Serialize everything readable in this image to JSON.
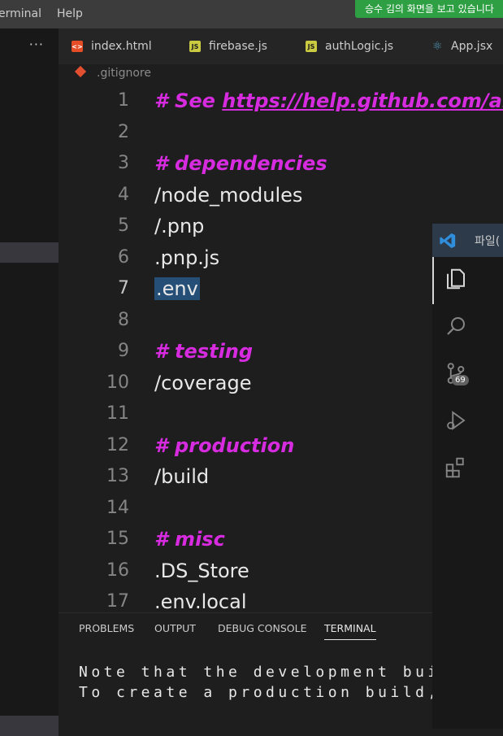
{
  "menu": {
    "terminal_label": "erminal",
    "help_label": "Help"
  },
  "sharing_banner": "승수 김의 화면을 보고 있습니다",
  "sidebar": {
    "more_label": "···"
  },
  "tabs": [
    {
      "label": "index.html",
      "icon": "html-icon",
      "color": "#e44d26"
    },
    {
      "label": "firebase.js",
      "icon": "js-icon",
      "color": "#cbcb41"
    },
    {
      "label": "authLogic.js",
      "icon": "js-icon",
      "color": "#cbcb41"
    },
    {
      "label": "App.jsx",
      "icon": "react-icon",
      "color": "#519aba"
    }
  ],
  "breadcrumb": {
    "file": ".gitignore"
  },
  "editor": {
    "lines": [
      {
        "n": "1",
        "text": "# See ",
        "url": "https://help.github.com/articles",
        "kind": "comment"
      },
      {
        "n": "2",
        "text": "",
        "kind": "blank"
      },
      {
        "n": "3",
        "text": "# dependencies",
        "kind": "comment"
      },
      {
        "n": "4",
        "text": "/node_modules",
        "kind": "code"
      },
      {
        "n": "5",
        "text": "/.pnp",
        "kind": "code"
      },
      {
        "n": "6",
        "text": ".pnp.js",
        "kind": "code"
      },
      {
        "n": "7",
        "text": ".env",
        "kind": "code",
        "highlight": true,
        "current": true
      },
      {
        "n": "8",
        "text": "",
        "kind": "blank"
      },
      {
        "n": "9",
        "text": "# testing",
        "kind": "comment"
      },
      {
        "n": "10",
        "text": "/coverage",
        "kind": "code"
      },
      {
        "n": "11",
        "text": "",
        "kind": "blank"
      },
      {
        "n": "12",
        "text": "# production",
        "kind": "comment"
      },
      {
        "n": "13",
        "text": "/build",
        "kind": "code"
      },
      {
        "n": "14",
        "text": "",
        "kind": "blank"
      },
      {
        "n": "15",
        "text": "# misc",
        "kind": "comment"
      },
      {
        "n": "16",
        "text": ".DS_Store",
        "kind": "code"
      },
      {
        "n": "17",
        "text": ".env.local",
        "kind": "code"
      }
    ]
  },
  "panel": {
    "tabs": [
      "PROBLEMS",
      "OUTPUT",
      "DEBUG CONSOLE",
      "TERMINAL"
    ],
    "active_tab": "TERMINAL",
    "terminal_lines": [
      "Note that the development bui",
      "To create a production build,"
    ]
  },
  "overlay": {
    "title": "파일(",
    "scm_badge": "69",
    "icons": [
      "files-icon",
      "search-icon",
      "source-control-icon",
      "run-debug-icon",
      "extensions-icon"
    ]
  },
  "colors": {
    "comment": "#d72be0",
    "accent": "#2ea043"
  }
}
